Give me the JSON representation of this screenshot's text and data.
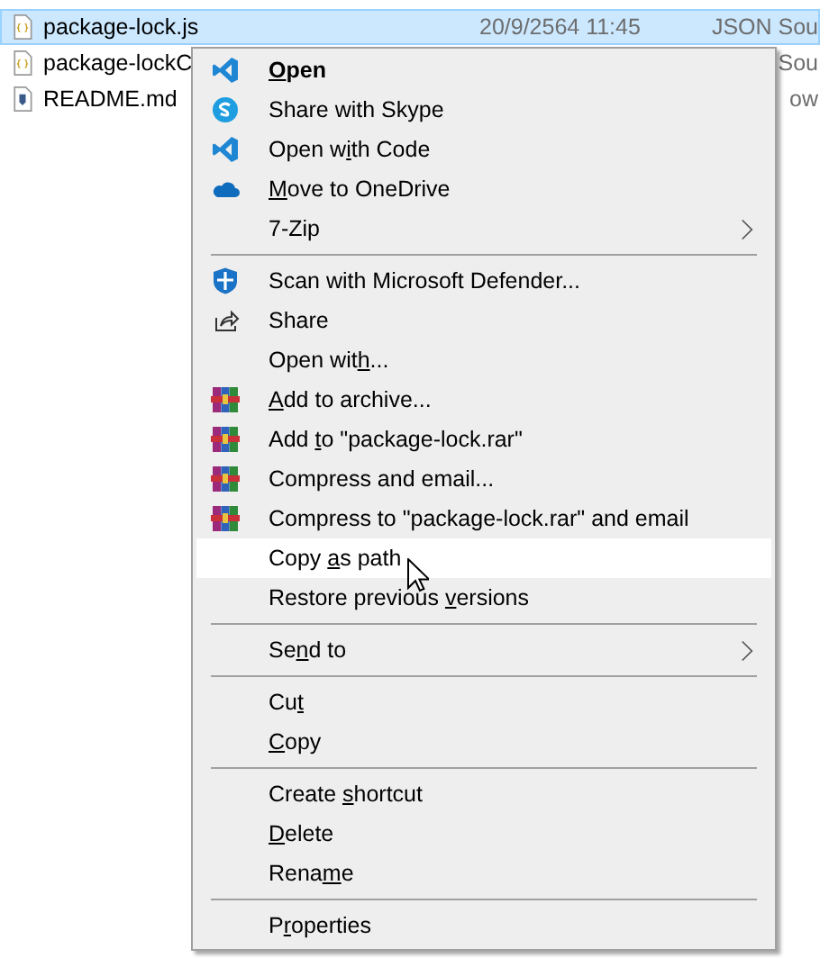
{
  "files": [
    {
      "name": "package-lock.js",
      "kind": "json",
      "selected": true,
      "date": "20/9/2564 11:45",
      "type": "JSON Sou"
    },
    {
      "name": "package-lockC",
      "kind": "json",
      "selected": false,
      "type": "Sou"
    },
    {
      "name": "README.md",
      "kind": "markdown",
      "selected": false,
      "type": "ow"
    }
  ],
  "menu": {
    "groups": [
      [
        {
          "key": "O",
          "post": "pen",
          "kind": "code",
          "bold": true,
          "submenu": false,
          "selected": false
        },
        {
          "pre": "Share with Skype",
          "kind": "skype",
          "bold": false,
          "submenu": false,
          "selected": false
        },
        {
          "pre": "Open w",
          "key": "i",
          "post": "th Code",
          "kind": "code",
          "bold": false,
          "submenu": false,
          "selected": false
        },
        {
          "key": "M",
          "post": "ove to OneDrive",
          "kind": "onedrive",
          "bold": false,
          "submenu": false,
          "selected": false
        },
        {
          "pre": "7-Zip",
          "kind": "plain",
          "bold": false,
          "submenu": true,
          "selected": false
        }
      ],
      [
        {
          "pre": "Scan with Microsoft Defender...",
          "kind": "shield",
          "bold": false,
          "submenu": false,
          "selected": false
        },
        {
          "pre": "Share",
          "kind": "share",
          "bold": false,
          "submenu": false,
          "selected": false
        },
        {
          "pre": "Open wit",
          "key": "h",
          "post": "...",
          "kind": "plain",
          "bold": false,
          "submenu": false,
          "selected": false
        },
        {
          "key": "A",
          "post": "dd to archive...",
          "kind": "archive",
          "bold": false,
          "submenu": false,
          "selected": false
        },
        {
          "pre": "Add ",
          "key": "t",
          "post": "o \"package-lock.rar\"",
          "kind": "archive",
          "bold": false,
          "submenu": false,
          "selected": false
        },
        {
          "pre": "Compress and email...",
          "kind": "archive",
          "bold": false,
          "submenu": false,
          "selected": false
        },
        {
          "pre": "Compress to \"package-lock.rar\" and email",
          "kind": "archive",
          "bold": false,
          "submenu": false,
          "selected": false
        },
        {
          "pre": "Copy ",
          "key": "a",
          "post": "s path",
          "kind": "plain",
          "bold": false,
          "submenu": false,
          "selected": true
        },
        {
          "pre": "Restore previous ",
          "key": "v",
          "post": "ersions",
          "kind": "plain",
          "bold": false,
          "submenu": false,
          "selected": false
        }
      ],
      [
        {
          "pre": "Se",
          "key": "n",
          "post": "d to",
          "kind": "plain",
          "bold": false,
          "submenu": true,
          "selected": false
        }
      ],
      [
        {
          "pre": "Cu",
          "key": "t",
          "kind": "plain",
          "bold": false,
          "submenu": false,
          "selected": false
        },
        {
          "key": "C",
          "post": "opy",
          "kind": "plain",
          "bold": false,
          "submenu": false,
          "selected": false
        }
      ],
      [
        {
          "pre": "Create ",
          "key": "s",
          "post": "hortcut",
          "kind": "plain",
          "bold": false,
          "submenu": false,
          "selected": false
        },
        {
          "key": "D",
          "post": "elete",
          "kind": "plain",
          "bold": false,
          "submenu": false,
          "selected": false
        },
        {
          "pre": "Rena",
          "key": "m",
          "post": "e",
          "kind": "plain",
          "bold": false,
          "submenu": false,
          "selected": false
        }
      ],
      [
        {
          "pre": "P",
          "key": "r",
          "post": "operties",
          "kind": "plain",
          "bold": false,
          "submenu": false,
          "selected": false
        }
      ]
    ]
  }
}
